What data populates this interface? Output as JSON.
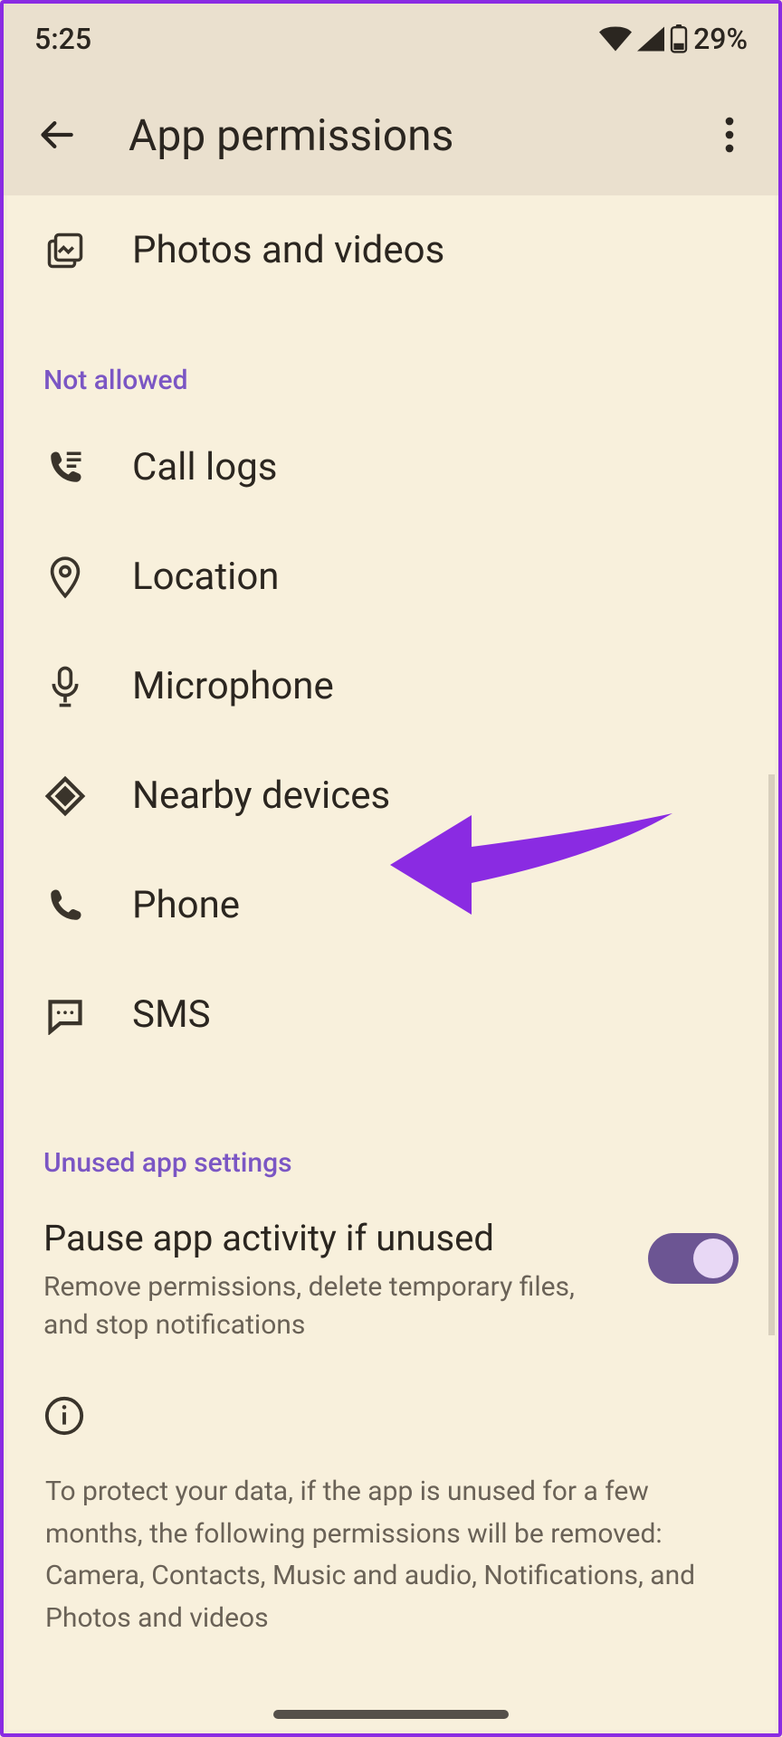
{
  "status": {
    "time": "5:25",
    "battery": "29%"
  },
  "header": {
    "title": "App permissions"
  },
  "allowed_partial": [
    {
      "key": "photos",
      "label": "Photos and videos",
      "icon": "photos-icon"
    }
  ],
  "section_not_allowed": "Not allowed",
  "not_allowed": [
    {
      "key": "call-logs",
      "label": "Call logs",
      "icon": "call-logs-icon"
    },
    {
      "key": "location",
      "label": "Location",
      "icon": "location-icon"
    },
    {
      "key": "microphone",
      "label": "Microphone",
      "icon": "microphone-icon"
    },
    {
      "key": "nearby",
      "label": "Nearby devices",
      "icon": "nearby-icon"
    },
    {
      "key": "phone",
      "label": "Phone",
      "icon": "phone-icon"
    },
    {
      "key": "sms",
      "label": "SMS",
      "icon": "sms-icon"
    }
  ],
  "section_unused": "Unused app settings",
  "unused_toggle": {
    "title": "Pause app activity if unused",
    "desc": "Remove permissions, delete temporary files, and stop notifications",
    "on": true
  },
  "info_text": "To protect your data, if the app is unused for a few months, the following permissions will be removed: Camera, Contacts, Music and audio, Notifications, and Photos and videos"
}
